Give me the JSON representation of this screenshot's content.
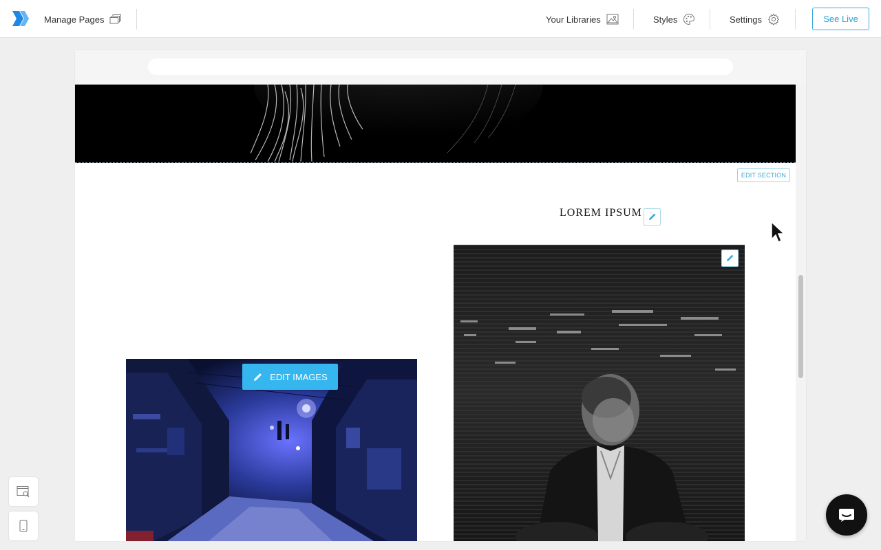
{
  "topbar": {
    "manage_pages": "Manage Pages",
    "your_libraries": "Your Libraries",
    "styles": "Styles",
    "settings": "Settings",
    "see_live": "See Live"
  },
  "section": {
    "edit_section": "EDIT SECTION",
    "heading": "LOREM IPSUM",
    "edit_images": "EDIT IMAGES"
  },
  "colors": {
    "accent": "#36b6ee",
    "brand": "#2a9fd8",
    "logo": "#1e88e5"
  },
  "icons": {
    "logo": "builder-logo-icon",
    "manage_pages": "pages-stack-icon",
    "libraries": "image-library-icon",
    "styles": "palette-icon",
    "settings": "gear-icon",
    "pencil": "pencil-icon",
    "preview": "browser-search-icon",
    "mobile": "mobile-device-icon",
    "chat": "chat-bubble-icon"
  }
}
